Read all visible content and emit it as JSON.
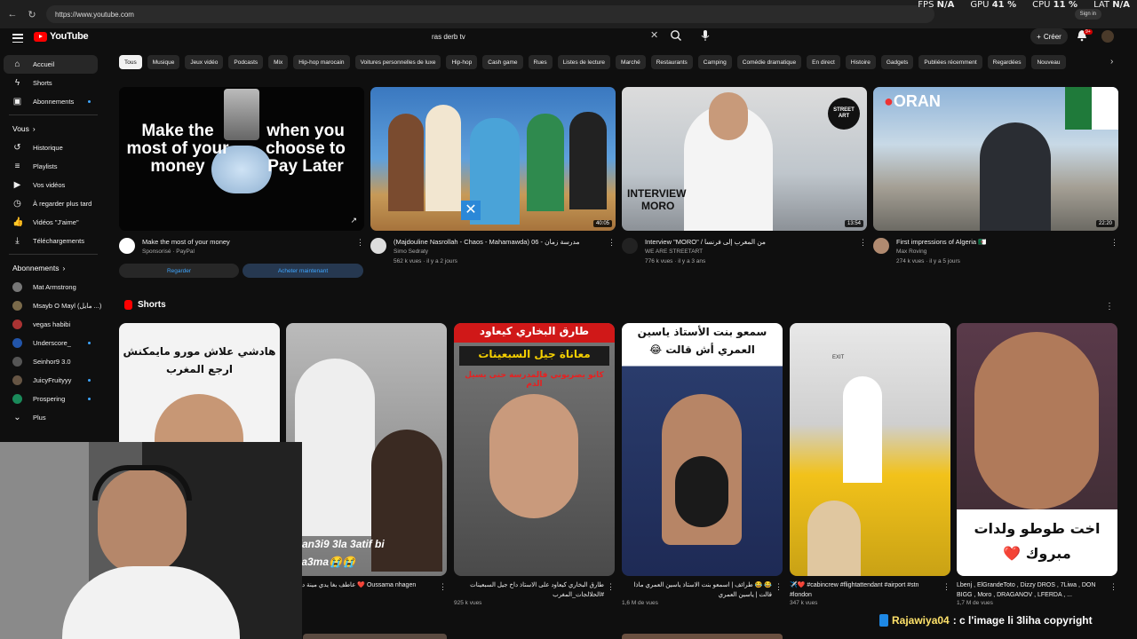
{
  "browser": {
    "url": "https://www.youtube.com",
    "signin": "Sign in"
  },
  "stats": {
    "fps_label": "FPS",
    "fps": "N/A",
    "gpu_label": "GPU",
    "gpu": "41 %",
    "cpu_label": "CPU",
    "cpu": "11 %",
    "lat_label": "LAT",
    "lat": "N/A"
  },
  "header": {
    "logo": "YouTube",
    "search_value": "ras derb tv",
    "create_label": "Créer",
    "notif_badge": "9+"
  },
  "sidebar": {
    "main": [
      {
        "label": "Accueil",
        "icon": "home-icon"
      },
      {
        "label": "Shorts",
        "icon": "shorts-icon"
      },
      {
        "label": "Abonnements",
        "icon": "subscriptions-icon"
      }
    ],
    "you_title": "Vous",
    "you": [
      {
        "label": "Historique"
      },
      {
        "label": "Playlists"
      },
      {
        "label": "Vos vidéos"
      },
      {
        "label": "À regarder plus tard"
      },
      {
        "label": "Vidéos \"J'aime\""
      },
      {
        "label": "Téléchargements"
      }
    ],
    "subs_title": "Abonnements",
    "subs": [
      {
        "label": "Mat Armstrong",
        "color": "#777"
      },
      {
        "label": "Msayb O Mayl (مايل ...)",
        "color": "#7a6a4a"
      },
      {
        "label": "vegas habibi",
        "color": "#a33"
      },
      {
        "label": "Underscore_",
        "color": "#2255aa"
      },
      {
        "label": "Seinhor9 3.0",
        "color": "#555"
      },
      {
        "label": "JuicyFruityyy",
        "color": "#665544"
      },
      {
        "label": "Prospering",
        "color": "#1a8a5a"
      }
    ],
    "more": "Plus"
  },
  "chips": [
    "Tous",
    "Musique",
    "Jeux vidéo",
    "Podcasts",
    "Mix",
    "Hip-hop marocain",
    "Voitures personnelles de luxe",
    "Hip-hop",
    "Cash game",
    "Rues",
    "Listes de lecture",
    "Marché",
    "Restaurants",
    "Camping",
    "Comédie dramatique",
    "En direct",
    "Histoire",
    "Gadgets",
    "Publiées récemment",
    "Regardées",
    "Nouveau"
  ],
  "videos": [
    {
      "title": "Make the most of your money",
      "channel": "Sponsorisé · PayPal",
      "stats": "",
      "thumb_left": "Make the most of your money",
      "thumb_right": "when you choose to Pay Later",
      "watch": "Regarder",
      "buy": "Acheter maintenant"
    },
    {
      "title": "(Majdouline Nasrollah - Chaos - Mahamawda) 06 - مدرسة زمان",
      "channel": "Simo Sedraty",
      "stats": "562 k vues · il y a 2 jours",
      "duration": "40:05"
    },
    {
      "title": "Interview \"MORO\" / من المغرب إلى فرنسا",
      "channel": "WE ARE STREETART",
      "stats": "776 k vues · il y a 3 ans",
      "duration": "13:54",
      "thumb_text1": "INTERVIEW",
      "thumb_text2": "MORO",
      "badge_text": "STREET ART"
    },
    {
      "title": "First impressions of Algeria 🇩🇿",
      "channel": "Max Roving",
      "stats": "274 k vues · il y a 5 jours",
      "duration": "22:20",
      "thumb_text": "ORAN"
    }
  ],
  "shorts_title": "Shorts",
  "shorts": [
    {
      "title": "",
      "views": "",
      "overtext": "هادشي علاش مورو مايمكنش ارجع المغرب"
    },
    {
      "title": "عاطف بغا يدي مينة ديال كو ❤️ Oussama nhagen",
      "views": "vues",
      "overtext": "Xan3i9 3la 3atif bi na3ma😭😭"
    },
    {
      "title": "طارق البخاري كيعاود على الاستاذ داخ جيل السبعينات #الحلالجات_المغرب",
      "views": "925 k vues",
      "overtext": "طارق البخاري كيعاود",
      "overtext2": "معاناة جيل السبعينات",
      "overtext3": "كانو يضربوني فالمدرسة حتى يسيل الدم"
    },
    {
      "title": "😂 😂 طرائف | اسمعو بنت الاستاذ ياسين العمري ماذا قالت | ياسين العمري",
      "views": "1,6 M de vues",
      "overtext": "سمعو بنت الأستاذ ياسين العمري أش قالت 😂"
    },
    {
      "title": "✈️❤️ #cabincrew #flightattendant #airport #stn #london",
      "views": "347 k vues",
      "overtext": "EXIT"
    },
    {
      "title": "Lbenj , ElGrandeToto , Dizzy DROS , 7Liwa , DON BIGG , Moro , DRAGANOV , LFERDA , ...",
      "views": "1,7 M de vues",
      "overtext": "اخت طوطو ولدات مبروك ❤️"
    }
  ],
  "caption": {
    "user": "Rajawiya04",
    "text": ": c l'image li 3liha copyright"
  }
}
